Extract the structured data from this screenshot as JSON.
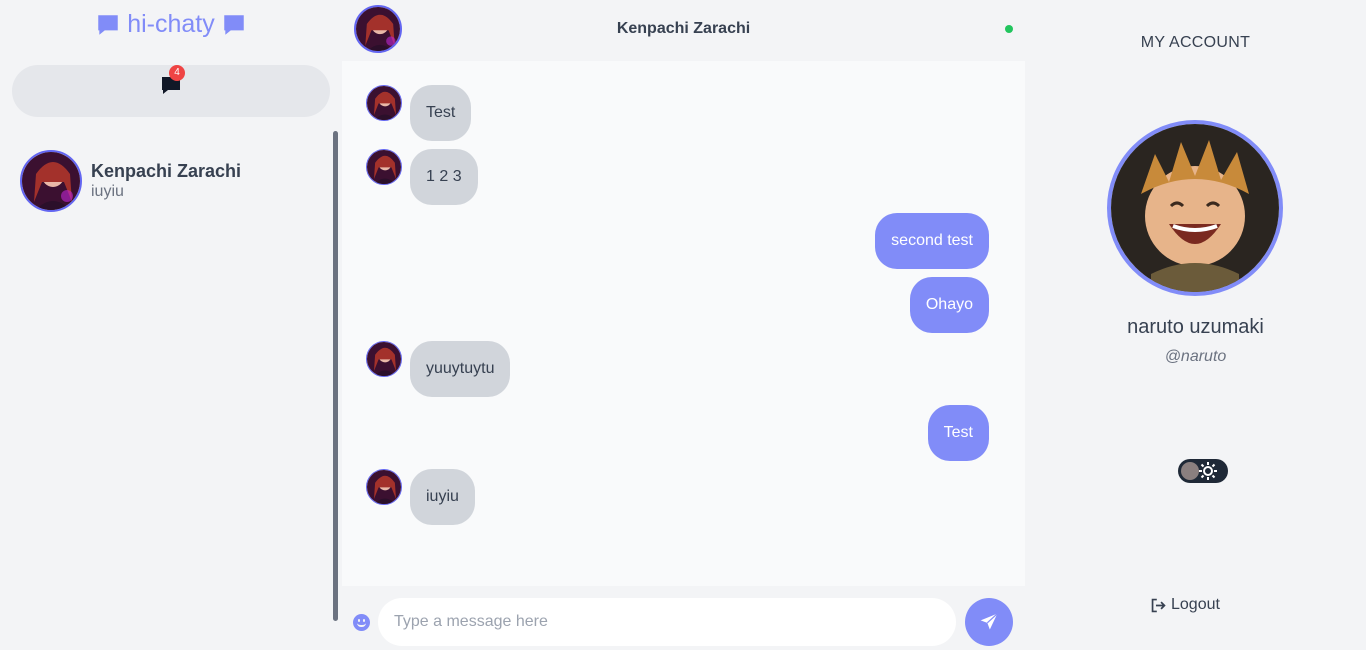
{
  "brand": {
    "name": "hi-chaty",
    "color": "#818cf8"
  },
  "notifications": {
    "count": "4",
    "icon": "chat-bubble-icon"
  },
  "contacts": [
    {
      "name": "Kenpachi Zarachi",
      "last_message": "iuyiu"
    }
  ],
  "chat": {
    "partner_name": "Kenpachi Zarachi",
    "status": "online",
    "messages": [
      {
        "direction": "in",
        "text": "Test"
      },
      {
        "direction": "in",
        "text": "1 2 3"
      },
      {
        "direction": "out",
        "text": "second test"
      },
      {
        "direction": "out",
        "text": "Ohayo"
      },
      {
        "direction": "in",
        "text": "yuuytuytu"
      },
      {
        "direction": "out",
        "text": "Test"
      },
      {
        "direction": "in",
        "text": "iuyiu"
      }
    ],
    "composer": {
      "placeholder": "Type a message here",
      "value": ""
    }
  },
  "account": {
    "title": "MY ACCOUNT",
    "display_name": "naruto uzumaki",
    "handle": "@naruto",
    "theme_toggle": "light",
    "logout_label": "Logout"
  },
  "colors": {
    "accent": "#818cf8",
    "incoming_bubble": "#d1d5db",
    "online": "#22c55e",
    "badge": "#ef4444"
  }
}
